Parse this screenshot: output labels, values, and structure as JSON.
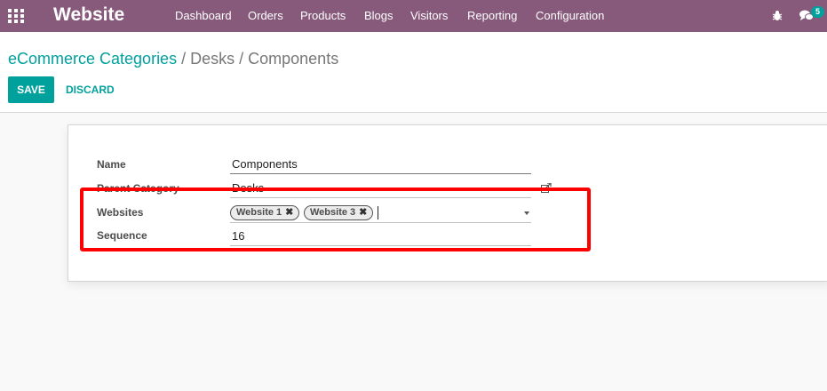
{
  "navbar": {
    "app_title": "Website",
    "menu": [
      "Dashboard",
      "Orders",
      "Products",
      "Blogs",
      "Visitors",
      "Reporting",
      "Configuration"
    ],
    "message_count": "5",
    "icons": [
      "apps-icon",
      "bug-icon",
      "chat-icon"
    ]
  },
  "breadcrumb": {
    "link": "eCommerce Categories",
    "separator": "/",
    "current": "Desks / Components"
  },
  "toolbar": {
    "save_label": "SAVE",
    "discard_label": "DISCARD"
  },
  "form": {
    "name_label": "Name",
    "name_value": "Components",
    "parent_label": "Parent Category",
    "parent_value": "Desks",
    "websites_label": "Websites",
    "websites_tags": [
      "Website 1",
      "Website 3"
    ],
    "sequence_label": "Sequence",
    "sequence_value": "16"
  },
  "colors": {
    "brand": "#875a7b",
    "accent": "#00a09d",
    "highlight": "#ff0000"
  }
}
